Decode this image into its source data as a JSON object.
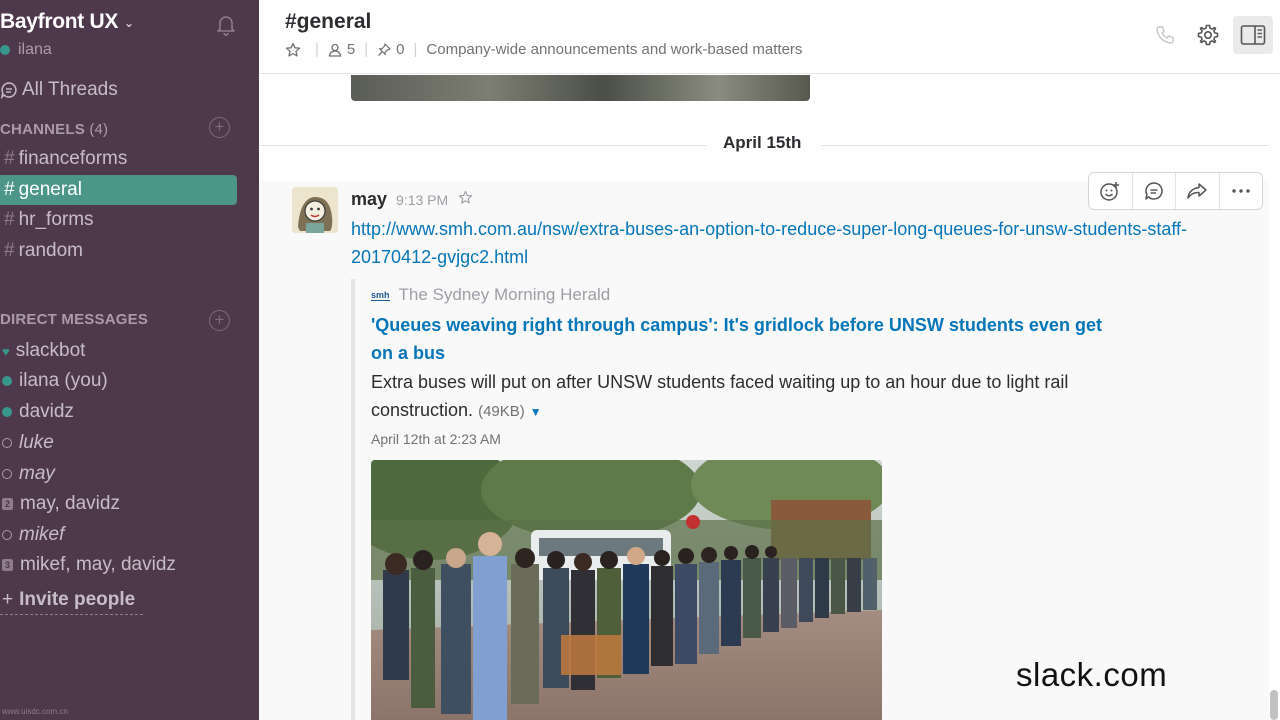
{
  "sidebar": {
    "team_name": "Bayfront UX",
    "username": "ilana",
    "all_threads": "All Threads",
    "channels_label": "CHANNELS",
    "channels_count": "(4)",
    "channels": [
      {
        "name": "financeforms",
        "active": false
      },
      {
        "name": "general",
        "active": true
      },
      {
        "name": "hr_forms",
        "active": false
      },
      {
        "name": "random",
        "active": false
      }
    ],
    "dm_label": "DIRECT MESSAGES",
    "dms": [
      {
        "name": "slackbot",
        "status": "heart"
      },
      {
        "name": "ilana (you)",
        "status": "online"
      },
      {
        "name": "davidz",
        "status": "online"
      },
      {
        "name": "luke",
        "status": "away"
      },
      {
        "name": "may",
        "status": "away"
      },
      {
        "name": "may, davidz",
        "status": "group",
        "count": "2"
      },
      {
        "name": "mikef",
        "status": "away"
      },
      {
        "name": "mikef, may, davidz",
        "status": "group",
        "count": "3"
      }
    ],
    "invite": "Invite people",
    "footer_watermark": "www.uisdc.com.cn"
  },
  "header": {
    "channel": "#general",
    "members": "5",
    "pins": "0",
    "purpose": "Company-wide announcements and work-based matters"
  },
  "day_divider": "April 15th",
  "message": {
    "sender": "may",
    "time": "9:13 PM",
    "link": "http://www.smh.com.au/nsw/extra-buses-an-option-to-reduce-super-long-queues-for-unsw-students-staff-20170412-gvjgc2.html",
    "attachment": {
      "source_badge": "smh",
      "source": "The Sydney Morning Herald",
      "title": "'Queues weaving right through campus': It's gridlock before UNSW students even get on a bus",
      "text": "Extra buses will put on after UNSW students faced waiting up to an hour due to light rail construction.",
      "size": "(49KB)",
      "date": "April 12th at 2:23 AM"
    }
  },
  "overlay_watermark": "slack.com",
  "colors": {
    "sidebar_bg": "#4d394b",
    "active_channel": "#4c9689",
    "online": "#38978d",
    "link": "#0576b9"
  }
}
